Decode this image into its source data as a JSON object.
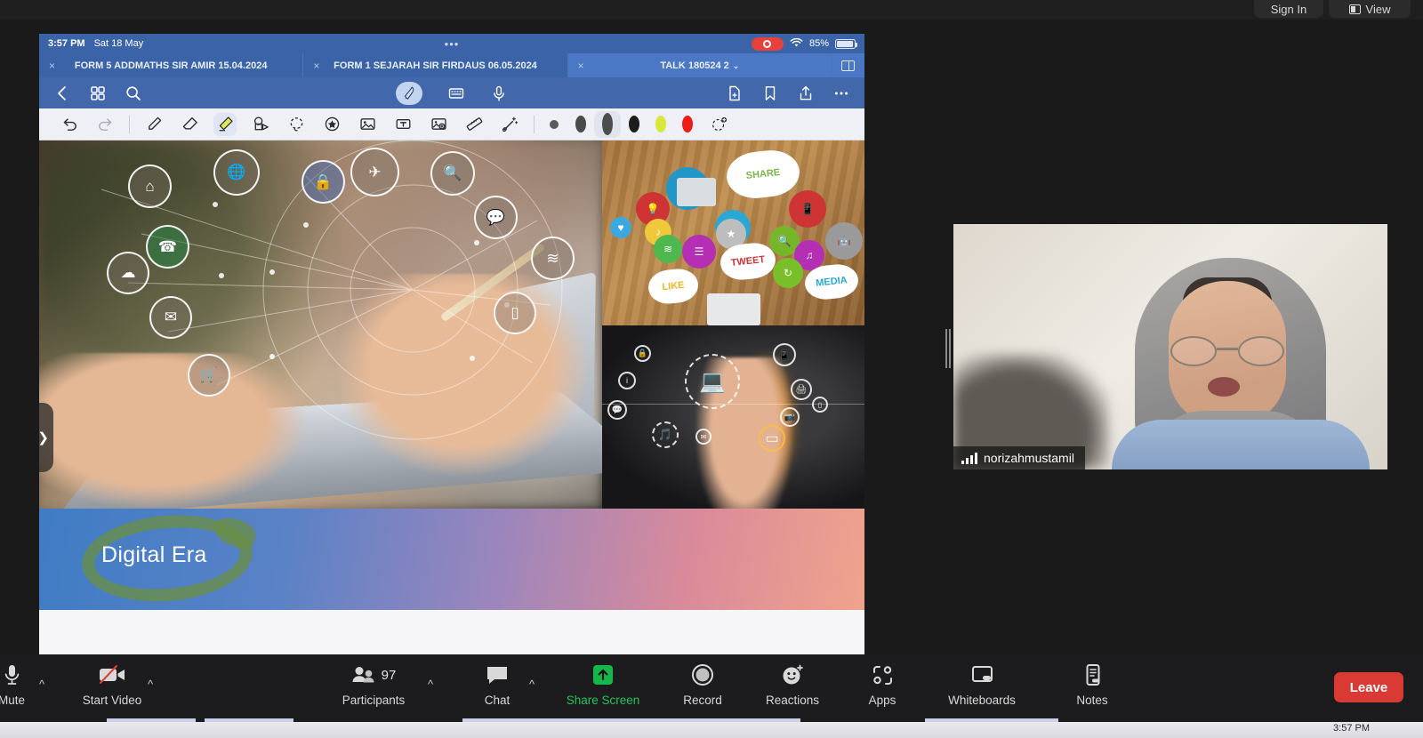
{
  "app": {
    "top_right_buttons": [
      {
        "id": "signin",
        "label": "Sign In"
      },
      {
        "id": "view",
        "label": "View"
      }
    ]
  },
  "shared_screen": {
    "ipad_status": {
      "time": "3:57 PM",
      "date": "Sat 18 May",
      "dots": "•••",
      "recording_icon": "record-icon",
      "wifi_icon": "wifi-icon",
      "battery_percent": "85%"
    },
    "tabs": [
      {
        "label": "FORM 5 ADDMATHS SIR AMIR 15.04.2024",
        "close": "×",
        "active": false
      },
      {
        "label": "FORM 1 SEJARAH SIR FIRDAUS 06.05.2024",
        "close": "×",
        "active": false
      },
      {
        "label": "TALK 180524 2",
        "close": "×",
        "chevron": "⌄",
        "active": true
      }
    ],
    "nav": {
      "back_icon": "chevron-left-icon",
      "grid_icon": "grid-icon",
      "search_icon": "search-icon",
      "pen_icon": "pen-tool-icon",
      "keyboard_icon": "keyboard-icon",
      "mic_icon": "microphone-icon",
      "new_note_icon": "new-note-icon",
      "bookmark_icon": "bookmark-icon",
      "share_icon": "share-icon",
      "more_icon": "more-icon",
      "sidebar_toggle_icon": "sidebar-toggle-icon"
    },
    "toolbar": {
      "tools": [
        {
          "name": "undo",
          "icon": "undo-icon",
          "selected": false
        },
        {
          "name": "redo",
          "icon": "redo-icon",
          "selected": false
        },
        {
          "name": "pencil",
          "icon": "pencil-icon",
          "selected": false
        },
        {
          "name": "eraser",
          "icon": "eraser-icon",
          "selected": false
        },
        {
          "name": "highlighter",
          "icon": "highlighter-icon",
          "selected": true
        },
        {
          "name": "shape",
          "icon": "shape-icon",
          "selected": false
        },
        {
          "name": "lasso",
          "icon": "lasso-icon",
          "selected": false
        },
        {
          "name": "sticker",
          "icon": "sticker-star-icon",
          "selected": false
        },
        {
          "name": "image",
          "icon": "image-icon",
          "selected": false
        },
        {
          "name": "text-box",
          "icon": "text-box-icon",
          "selected": false
        },
        {
          "name": "media-insert",
          "icon": "media-insert-icon",
          "selected": false
        },
        {
          "name": "ruler",
          "icon": "ruler-icon",
          "selected": false
        },
        {
          "name": "magic-wand",
          "icon": "magic-wand-icon",
          "selected": false
        }
      ],
      "colors": [
        {
          "hex": "#5a5a5a",
          "size": 10,
          "selected": false
        },
        {
          "hex": "#4a4a4a",
          "size": 19,
          "selected": false
        },
        {
          "hex": "#4d4d4d",
          "size": 25,
          "selected": true
        },
        {
          "hex": "#1c1c1c",
          "size": 19,
          "selected": false
        },
        {
          "hex": "#d7e83a",
          "size": 19,
          "selected": false
        },
        {
          "hex": "#ec1c16",
          "size": 19,
          "selected": false
        }
      ],
      "add_color_icon": "add-color-icon"
    },
    "slide": {
      "title": "Digital Era",
      "expand_handle_icon": "chevron-right-icon",
      "images": [
        {
          "name": "hands-phone-laptop-tech-icons",
          "alt": "Hands using smartphone and laptop with floating technology icons"
        },
        {
          "name": "social-media-desk-collage",
          "alt": "Overhead view of people at wooden desk with social media icons"
        },
        {
          "name": "finger-touch-hologram",
          "alt": "Finger touching holographic laptop interface"
        }
      ],
      "tech_icons": [
        "home",
        "globe",
        "lock",
        "airplane",
        "search",
        "chat",
        "wifi",
        "mobile",
        "mail",
        "cart",
        "cloud-upload",
        "contact-card"
      ],
      "social_words": [
        "SHARE",
        "TWEET",
        "LIKE",
        "MEDIA"
      ],
      "ink_annotation": "green-circle-annotation"
    }
  },
  "video": {
    "participant_name": "norizahmustamil",
    "signal_icon": "signal-bars-icon",
    "drag_handle_icon": "drag-handle-icon"
  },
  "zoom_controls": [
    {
      "name": "mute",
      "label": "Mute",
      "icon": "microphone-icon",
      "caret": "^",
      "active": false
    },
    {
      "name": "start-video",
      "label": "Start Video",
      "icon": "video-off-icon",
      "caret": "^",
      "active": false
    },
    {
      "name": "participants",
      "label": "Participants",
      "icon": "participants-icon",
      "count": "97",
      "caret": "^",
      "active": false
    },
    {
      "name": "chat",
      "label": "Chat",
      "icon": "chat-icon",
      "caret": "^",
      "active": false
    },
    {
      "name": "share-screen",
      "label": "Share Screen",
      "icon": "share-screen-icon",
      "active": true
    },
    {
      "name": "record",
      "label": "Record",
      "icon": "record-icon",
      "active": false
    },
    {
      "name": "reactions",
      "label": "Reactions",
      "icon": "reactions-icon",
      "active": false
    },
    {
      "name": "apps",
      "label": "Apps",
      "icon": "apps-icon",
      "active": false
    },
    {
      "name": "whiteboards",
      "label": "Whiteboards",
      "icon": "whiteboards-icon",
      "active": false
    },
    {
      "name": "notes",
      "label": "Notes",
      "icon": "notes-icon",
      "active": false
    }
  ],
  "leave": {
    "label": "Leave"
  },
  "os": {
    "clock": "3:57 PM"
  },
  "colors": {
    "accent_green": "#14b84a",
    "leave_red": "#d93a34",
    "ipad_blue": "#3b63a8",
    "nav_blue": "#4267ab"
  }
}
